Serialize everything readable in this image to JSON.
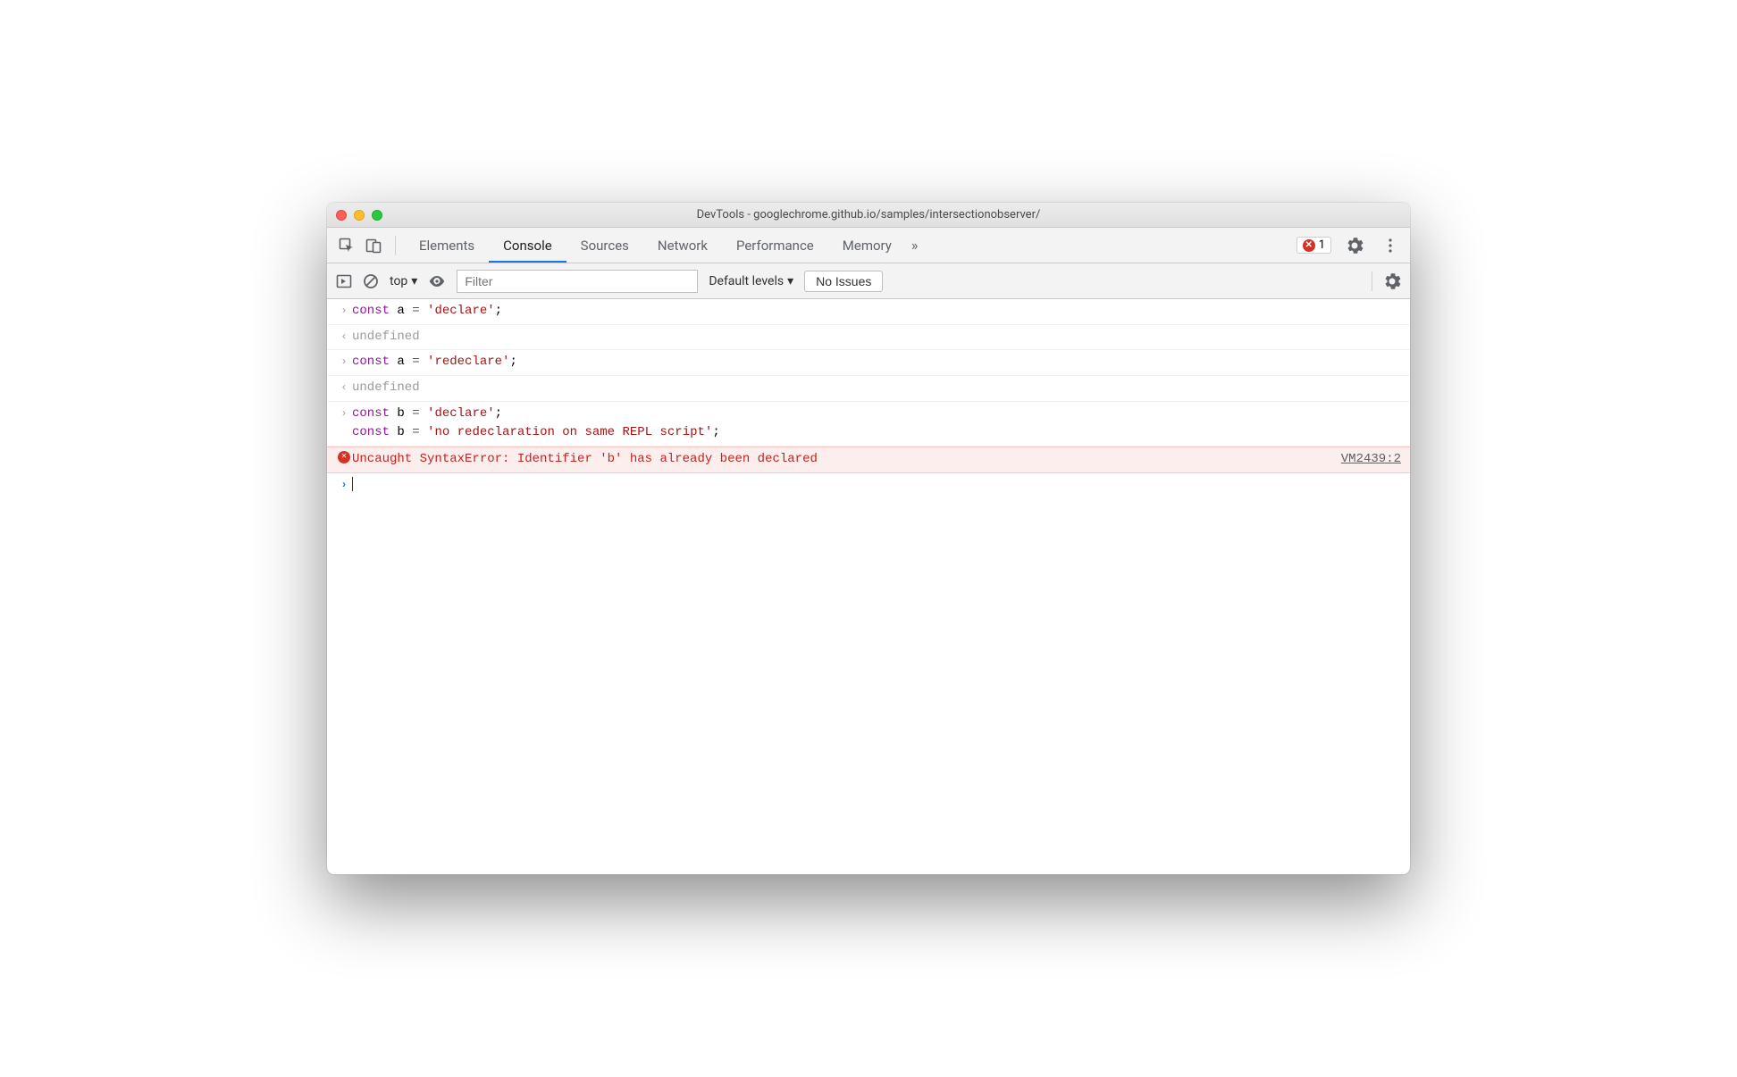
{
  "window": {
    "title": "DevTools - googlechrome.github.io/samples/intersectionobserver/"
  },
  "tabs": {
    "items": [
      "Elements",
      "Console",
      "Sources",
      "Network",
      "Performance",
      "Memory"
    ],
    "active_index": 1,
    "overflow_glyph": "»"
  },
  "error_badge": {
    "count": "1"
  },
  "toolbar": {
    "context": "top",
    "filter_placeholder": "Filter",
    "levels": "Default levels",
    "issues_label": "No Issues"
  },
  "console": {
    "rows": [
      {
        "type": "input",
        "tokens": [
          {
            "t": "kw",
            "v": "const"
          },
          {
            "t": "plain",
            "v": " a "
          },
          {
            "t": "op",
            "v": "="
          },
          {
            "t": "plain",
            "v": " "
          },
          {
            "t": "str",
            "v": "'declare'"
          },
          {
            "t": "plain",
            "v": ";"
          }
        ]
      },
      {
        "type": "result",
        "text": "undefined"
      },
      {
        "type": "input",
        "tokens": [
          {
            "t": "kw",
            "v": "const"
          },
          {
            "t": "plain",
            "v": " a "
          },
          {
            "t": "op",
            "v": "="
          },
          {
            "t": "plain",
            "v": " "
          },
          {
            "t": "str",
            "v": "'redeclare'"
          },
          {
            "t": "plain",
            "v": ";"
          }
        ]
      },
      {
        "type": "result",
        "text": "undefined"
      },
      {
        "type": "input-multi",
        "lines": [
          [
            {
              "t": "kw",
              "v": "const"
            },
            {
              "t": "plain",
              "v": " b "
            },
            {
              "t": "op",
              "v": "="
            },
            {
              "t": "plain",
              "v": " "
            },
            {
              "t": "str",
              "v": "'declare'"
            },
            {
              "t": "plain",
              "v": ";"
            }
          ],
          [
            {
              "t": "kw",
              "v": "const"
            },
            {
              "t": "plain",
              "v": " b "
            },
            {
              "t": "op",
              "v": "="
            },
            {
              "t": "plain",
              "v": " "
            },
            {
              "t": "str",
              "v": "'no redeclaration on same REPL script'"
            },
            {
              "t": "plain",
              "v": ";"
            }
          ]
        ]
      },
      {
        "type": "error",
        "text": "Uncaught SyntaxError: Identifier 'b' has already been declared",
        "link": "VM2439:2"
      },
      {
        "type": "prompt"
      }
    ]
  }
}
